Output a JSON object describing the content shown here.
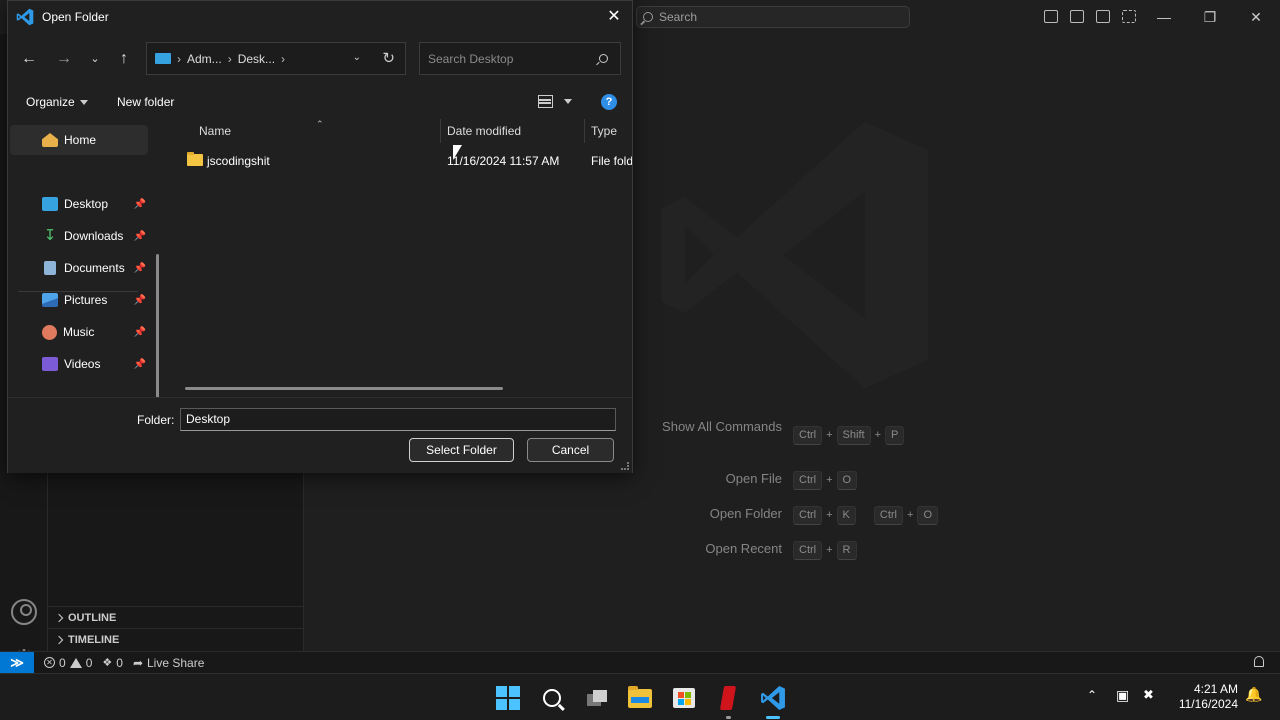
{
  "vscode": {
    "search_placeholder": "Search",
    "outline_label": "OUTLINE",
    "timeline_label": "TIMELINE",
    "shortcuts": [
      {
        "label": "Show All Commands",
        "keys": [
          [
            "Ctrl",
            "Shift",
            "P"
          ]
        ]
      },
      {
        "label": "Open File",
        "keys": [
          [
            "Ctrl",
            "O"
          ]
        ]
      },
      {
        "label": "Open Folder",
        "keys": [
          [
            "Ctrl",
            "K"
          ],
          [
            "Ctrl",
            "O"
          ]
        ]
      },
      {
        "label": "Open Recent",
        "keys": [
          [
            "Ctrl",
            "R"
          ]
        ]
      }
    ],
    "status": {
      "errors": "0",
      "warnings": "0",
      "ports": "0",
      "live_share": "Live Share"
    }
  },
  "dialog": {
    "title": "Open Folder",
    "breadcrumb": [
      "Adm...",
      "Desk..."
    ],
    "search_placeholder": "Search Desktop",
    "organize_label": "Organize",
    "new_folder_label": "New folder",
    "nav": [
      {
        "label": "Home",
        "icon": "home-icon",
        "pinned": false,
        "selected": true
      },
      {
        "label": "Desktop",
        "icon": "desktop-icon",
        "pinned": true
      },
      {
        "label": "Downloads",
        "icon": "download-icon",
        "pinned": true
      },
      {
        "label": "Documents",
        "icon": "document-icon",
        "pinned": true
      },
      {
        "label": "Pictures",
        "icon": "picture-icon",
        "pinned": true
      },
      {
        "label": "Music",
        "icon": "music-icon",
        "pinned": true
      },
      {
        "label": "Videos",
        "icon": "video-icon",
        "pinned": true
      }
    ],
    "columns": {
      "name": "Name",
      "date": "Date modified",
      "type": "Type"
    },
    "files": [
      {
        "name": "jscodingshit",
        "date": "11/16/2024 11:57 AM",
        "type": "File fold"
      }
    ],
    "folder_label": "Folder:",
    "folder_value": "Desktop",
    "select_label": "Select Folder",
    "cancel_label": "Cancel"
  },
  "taskbar": {
    "time": "4:21 AM",
    "date": "11/16/2024"
  },
  "colors": {
    "accent": "#0078d4",
    "vscode_blue": "#2f8fe6",
    "folder_yellow": "#f4c542"
  }
}
